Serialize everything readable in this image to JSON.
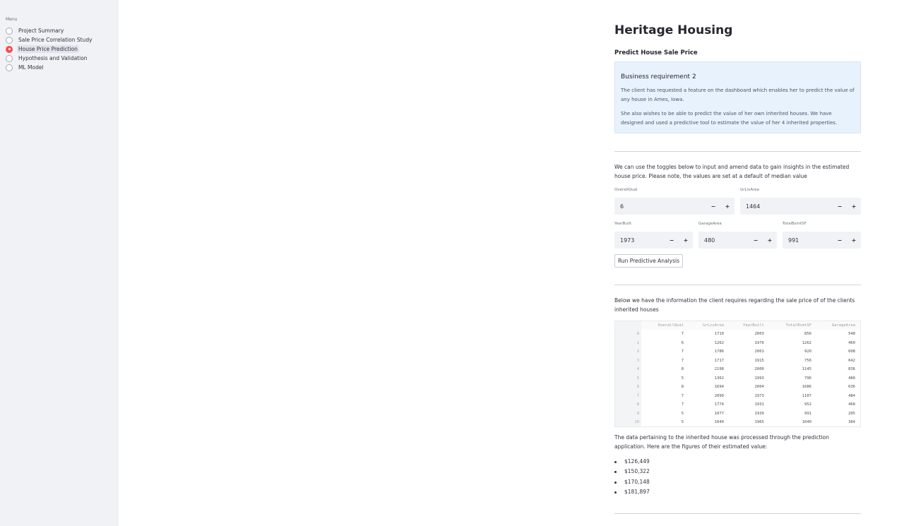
{
  "sidebar": {
    "menu_label": "Menu",
    "items": [
      {
        "label": "Project Summary",
        "selected": false
      },
      {
        "label": "Sale Price Correlation Study",
        "selected": false
      },
      {
        "label": "House Price Prediction",
        "selected": true
      },
      {
        "label": "Hypothesis and Validation",
        "selected": false
      },
      {
        "label": "ML Model",
        "selected": false
      }
    ]
  },
  "main": {
    "title": "Heritage Housing",
    "subtitle": "Predict House Sale Price",
    "info": {
      "heading": "Business requirement 2",
      "p1": "The client has requested a feature on the dashboard which enables her to predict the value of any house in Ames, Iowa.",
      "p2": "She also wishes to be able to predict the value of her own inherited houses. We have designed and used a predictive tool to estimate the value of her 4 inherited properties."
    },
    "toggle_text": "We can use the toggles below to input and amend data to gain insights in the estimated house price. Please note, the values are set at a default of median value",
    "inputs": {
      "overall_qual": {
        "label": "OverallQual",
        "value": "6"
      },
      "gr_liv_area": {
        "label": "GrLivArea",
        "value": "1464"
      },
      "year_built": {
        "label": "YearBuilt",
        "value": "1973"
      },
      "garage_area": {
        "label": "GarageArea",
        "value": "480"
      },
      "total_bsmt_sf": {
        "label": "TotalBsmtSF",
        "value": "991"
      },
      "minus": "−",
      "plus": "+"
    },
    "run_button": "Run Predictive Analysis",
    "table_intro": "Below we have the information the client requires regarding the sale price of of the clients inherited houses",
    "table": {
      "columns": [
        "OverallQual",
        "GrLivArea",
        "YearBuilt",
        "TotalBsmtSF",
        "GarageArea"
      ],
      "rows": [
        [
          "0",
          "7",
          "1710",
          "2003",
          "856",
          "548"
        ],
        [
          "1",
          "6",
          "1262",
          "1976",
          "1262",
          "460"
        ],
        [
          "2",
          "7",
          "1786",
          "2001",
          "920",
          "608"
        ],
        [
          "3",
          "7",
          "1717",
          "1915",
          "756",
          "642"
        ],
        [
          "4",
          "8",
          "2198",
          "2000",
          "1145",
          "836"
        ],
        [
          "5",
          "5",
          "1362",
          "1993",
          "796",
          "480"
        ],
        [
          "6",
          "8",
          "1694",
          "2004",
          "1686",
          "636"
        ],
        [
          "7",
          "7",
          "2090",
          "1973",
          "1107",
          "484"
        ],
        [
          "8",
          "7",
          "1774",
          "1931",
          "952",
          "468"
        ],
        [
          "9",
          "5",
          "1077",
          "1939",
          "991",
          "205"
        ],
        [
          "10",
          "5",
          "1040",
          "1965",
          "1040",
          "384"
        ]
      ]
    },
    "result_intro": "The data pertaining to the inherited house was processed through the prediction application. Here are the figures of their estimated value:",
    "estimates": [
      "$126,449",
      "$150,322",
      "$170,148",
      "$181,897"
    ]
  },
  "colors": {
    "accent": "#ff4b4b",
    "sidebar_bg": "#f0f2f6",
    "info_bg": "#e8f2fc"
  }
}
